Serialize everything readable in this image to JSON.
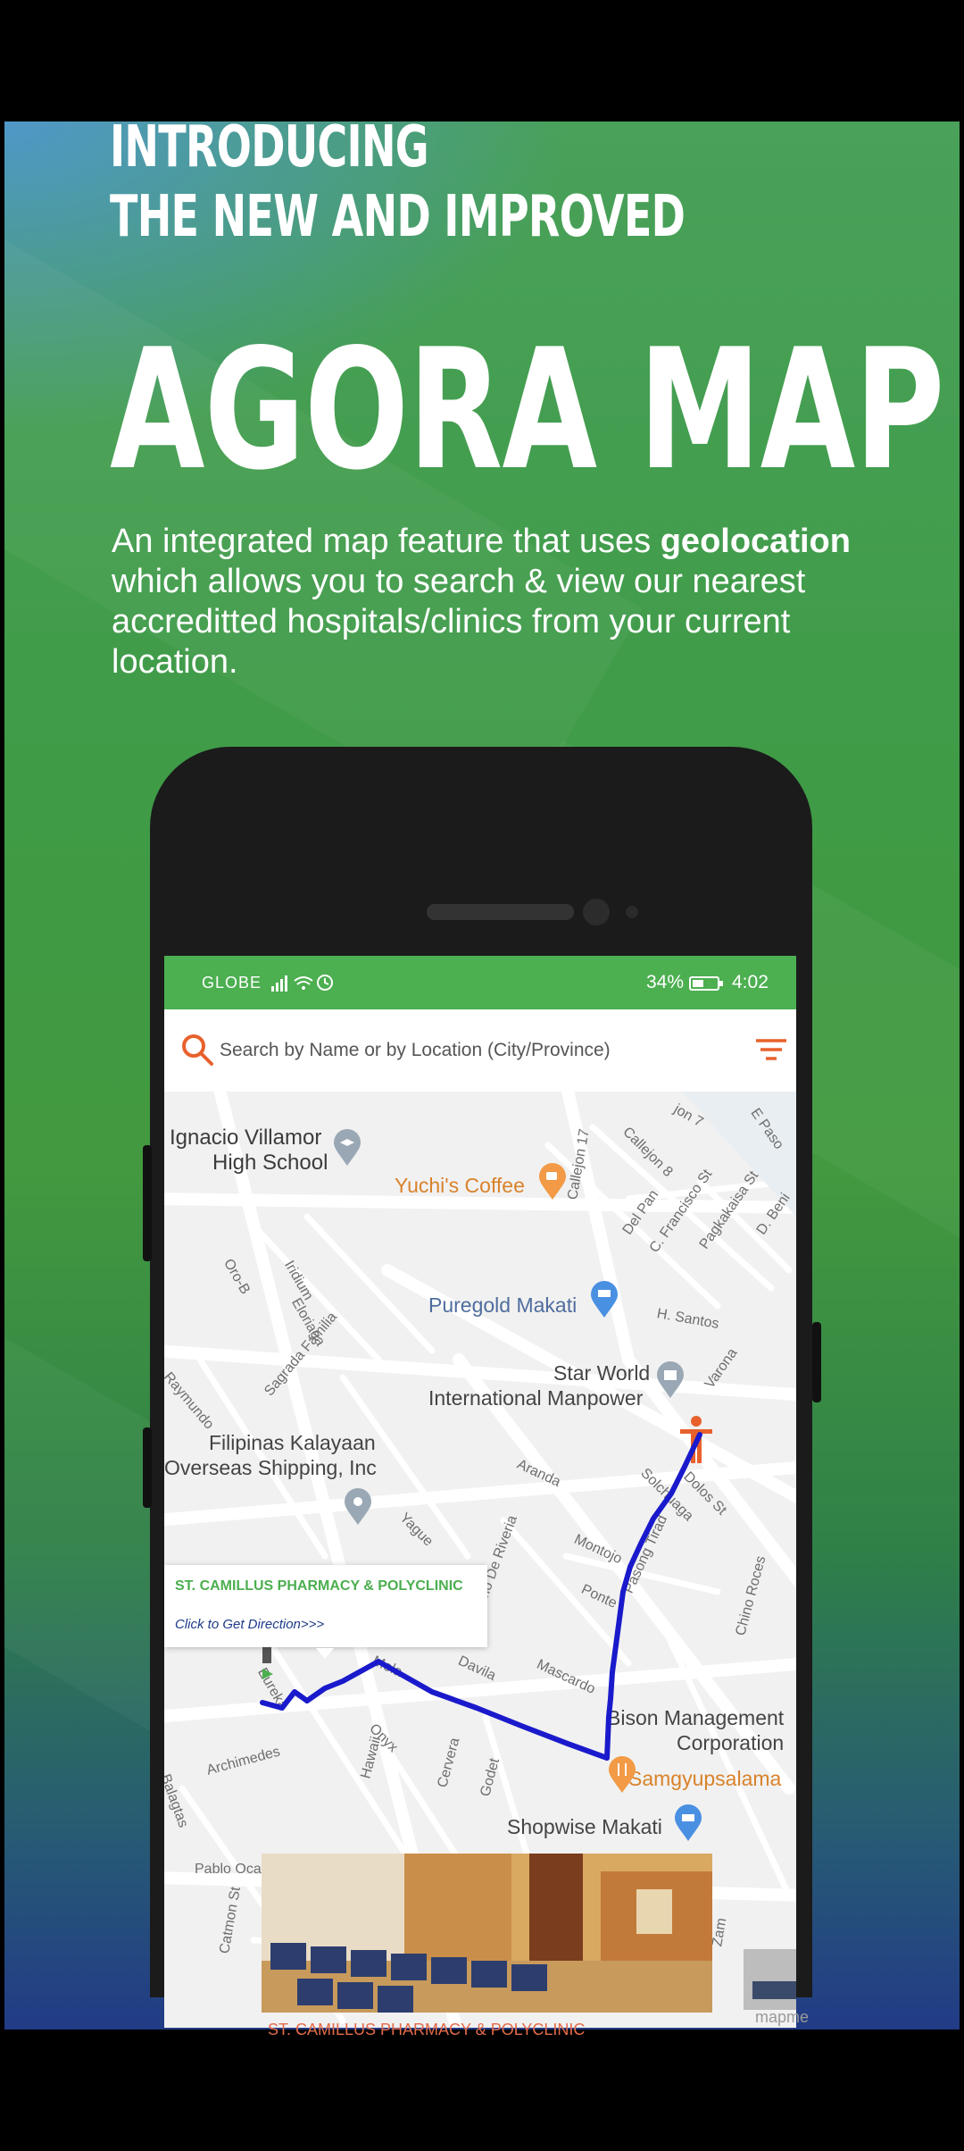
{
  "promo": {
    "intro_line1": "INTRODUCING",
    "intro_line2": "THE NEW AND IMPROVED",
    "title": "AGORA MAP",
    "desc_before": "An integrated map feature that uses ",
    "desc_bold": "geolocation",
    "desc_after": " which allows you to search & view our nearest accreditted hospitals/clinics from your current location."
  },
  "status_bar": {
    "carrier": "GLOBE",
    "battery": "34%",
    "time": "4:02"
  },
  "search": {
    "placeholder": "Search by Name or by Location (City/Province)"
  },
  "map": {
    "places": {
      "school_line1": "Ignacio Villamor",
      "school_line2": "High School",
      "coffee": "Yuchi's Coffee",
      "puregold": "Puregold Makati",
      "starworld_line1": "Star World",
      "starworld_line2": "International Manpower",
      "filipinas_line1": "Filipinas Kalayaan",
      "filipinas_line2": "Overseas Shipping, Inc",
      "bison_line1": "Bison Management",
      "bison_line2": "Corporation",
      "samgyup": "Samgyupsalama",
      "shopwise": "Shopwise Makati"
    },
    "streets": {
      "callejon17": "Callejon 17",
      "callejon8": "Callejon 8",
      "jon7": "jon 7",
      "epaso": "E Paso",
      "delpan": "Del Pan",
      "cfrancisco": "C. Francisco St",
      "pagkakaisa": "Pagkakaisa St",
      "dbeni": "D. Beni",
      "oro8": "Oro-B",
      "iridium": "Iridium",
      "eloriaga": "Eloriaga",
      "sagrada": "Sagrada Familia",
      "raymundo": "Raymundo",
      "hsantos": "H. Santos",
      "yague": "Yague",
      "aranda": "Aranda",
      "varona": "Varona",
      "solchuaga": "Solchuaga",
      "dolos": "Dolos St",
      "montojo": "Montojo",
      "primo": "Primo De Riveria",
      "ponte": "Ponte",
      "pasong": "Pasong Tirad",
      "mascardo": "Mascardo",
      "davila": "Davila",
      "mola": "Mola",
      "eureka": "Eureka",
      "chino": "Chino Roces",
      "onyx": "Onyx",
      "archimedes": "Archimedes",
      "balagtas": "Balagtas",
      "hawaii": "Hawaii",
      "cervera": "Cervera",
      "godet": "Godet",
      "pablo": "Pablo Oca",
      "catmon": "Catmon St",
      "zam": "Zam"
    },
    "popup": {
      "title": "ST. CAMILLUS PHARMACY & POLYCLINIC",
      "link": "Click to Get Direction>>>"
    },
    "bottom_card_title": "ST. CAMILLUS PHARMACY & POLYCLINIC",
    "watermark": "mapme"
  },
  "colors": {
    "status_bar": "#4caf50",
    "route": "#1a1acc",
    "accent_orange": "#e8612c",
    "popup_title": "#4caf50"
  }
}
